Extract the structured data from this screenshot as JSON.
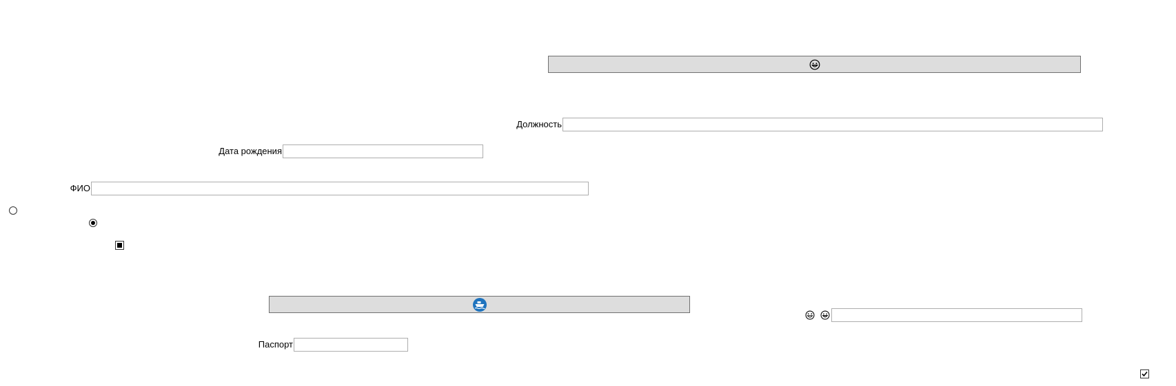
{
  "form": {
    "position_label": "Должность",
    "position_value": "",
    "birthdate_label": "Дата рождения",
    "birthdate_value": "",
    "fio_label": "ФИО",
    "fio_value": "",
    "passport_label": "Паспорт",
    "passport_value": "",
    "emoji_field_value": ""
  },
  "buttons": {
    "top_button_icon": "grinning-face-icon",
    "bottom_button_icon": "blue-ship-badge-icon",
    "bottom_button_color": "#1e73be"
  },
  "controls": {
    "radio_1_checked": false,
    "radio_2_checked": true,
    "checkbox_1_state": "indeterminate",
    "checkbox_2_checked": true
  },
  "icons": {
    "emoji_label_1": "laughing-face-icon",
    "emoji_label_2": "grinning-face-icon"
  }
}
